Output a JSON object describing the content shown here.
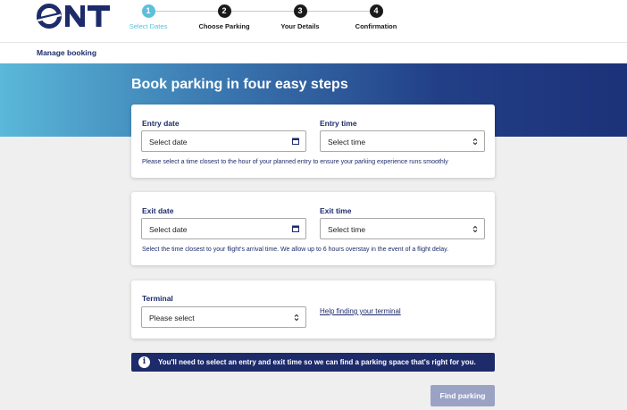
{
  "brand": {
    "logo_text": "ONT",
    "color": "#1d2b6b"
  },
  "steps": [
    {
      "number": "1",
      "label": "Select Dates",
      "active": true
    },
    {
      "number": "2",
      "label": "Choose Parking",
      "active": false
    },
    {
      "number": "3",
      "label": "Your Details",
      "active": false
    },
    {
      "number": "4",
      "label": "Confirmation",
      "active": false
    }
  ],
  "nav": {
    "manage_booking": "Manage booking"
  },
  "hero": {
    "title": "Book parking in four easy steps"
  },
  "entry": {
    "date_label": "Entry date",
    "date_placeholder": "Select date",
    "time_label": "Entry time",
    "time_placeholder": "Select time",
    "help": "Please select a time closest to the hour of your planned entry to ensure your parking experience runs smoothly"
  },
  "exit": {
    "date_label": "Exit date",
    "date_placeholder": "Select date",
    "time_label": "Exit time",
    "time_placeholder": "Select time",
    "help": "Select the time closest to your flight's arrival time. We allow up to 6 hours overstay in the event of a flight delay."
  },
  "terminal": {
    "label": "Terminal",
    "placeholder": "Please select",
    "help_link": "Help finding your terminal"
  },
  "notice": {
    "icon": "info-icon",
    "text": "You'll need to select an entry and exit time so we can find a parking space that's right for you."
  },
  "actions": {
    "find_parking": "Find parking"
  },
  "colors": {
    "accent": "#5cbfdc",
    "navy": "#1d2b6b",
    "button_disabled": "#9aa3c4"
  }
}
